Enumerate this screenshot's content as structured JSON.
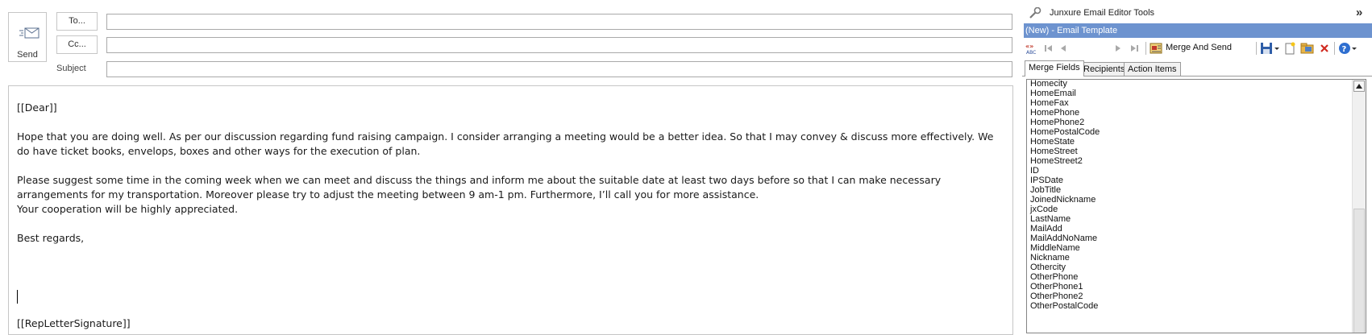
{
  "compose": {
    "send_label": "Send",
    "to_label": "To...",
    "cc_label": "Cc...",
    "subject_label": "Subject",
    "to_value": "",
    "cc_value": "",
    "subject_value": "",
    "body": {
      "greeting": "[[Dear]]",
      "paragraph1": "Hope that you are doing well. As per our discussion regarding fund raising campaign. I consider arranging a meeting would be a better idea. So that I may convey & discuss more effectively. We do have ticket books, envelops, boxes and other ways for the execution of plan.",
      "paragraph2": "Please suggest some time in the coming week when we can meet and discuss the things and inform me about the suitable date at least two days before so that I can make necessary arrangements for my transportation. Moreover please try to adjust the meeting between 9 am-1 pm. Furthermore, I’ll call  you for more assistance.",
      "paragraph2_line2": "Your cooperation will be highly appreciated.",
      "closing": "Best regards,",
      "signature": "[[RepLetterSignature]]"
    }
  },
  "pane": {
    "title": "Junxure Email Editor Tools",
    "template_title": "(New) - Email Template",
    "toolbar": {
      "merge_send_label": "Merge And Send"
    },
    "tabs": [
      {
        "label": "Merge Fields"
      },
      {
        "label": "Recipients"
      },
      {
        "label": "Action Items"
      }
    ],
    "merge_fields": [
      "Homecity",
      "HomeEmail",
      "HomeFax",
      "HomePhone",
      "HomePhone2",
      "HomePostalCode",
      "HomeState",
      "HomeStreet",
      "HomeStreet2",
      "ID",
      "IPSDate",
      "JobTitle",
      "JoinedNickname",
      "jxCode",
      "LastName",
      "MailAdd",
      "MailAddNoName",
      "MiddleName",
      "Nickname",
      "Othercity",
      "OtherPhone",
      "OtherPhone1",
      "OtherPhone2",
      "OtherPostalCode"
    ]
  },
  "colors": {
    "template_bar": "#6d93cf",
    "border": "#c6c6c6"
  }
}
